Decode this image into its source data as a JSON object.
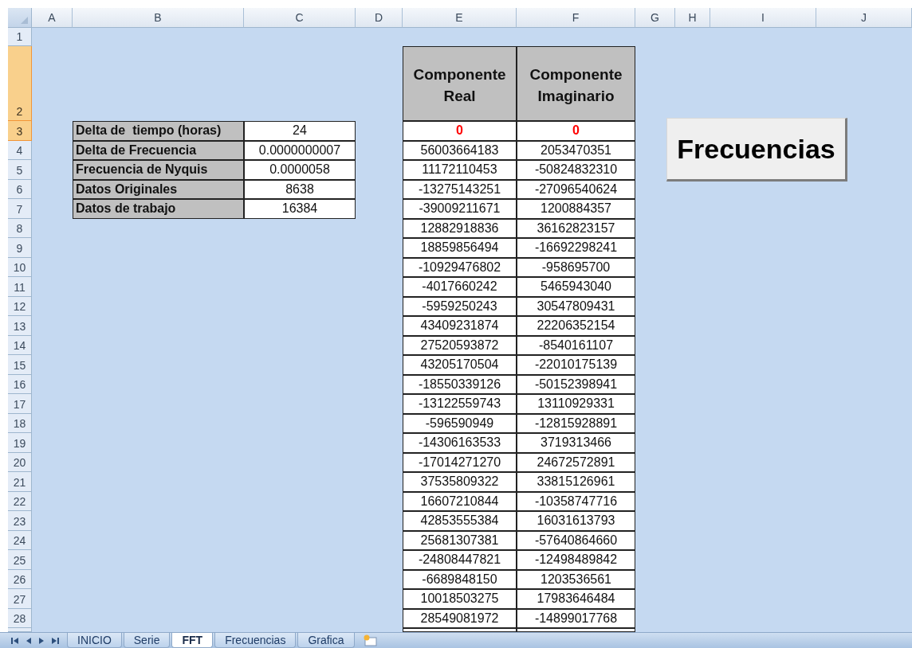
{
  "columns": [
    "A",
    "B",
    "C",
    "D",
    "E",
    "F",
    "G",
    "H",
    "I",
    "J"
  ],
  "rows": [
    {
      "label": "1",
      "selected": false
    },
    {
      "label": "2",
      "selected": true
    },
    {
      "label": "3",
      "selected": true
    },
    {
      "label": "4",
      "selected": false
    },
    {
      "label": "5",
      "selected": false
    },
    {
      "label": "6",
      "selected": false
    },
    {
      "label": "7",
      "selected": false
    },
    {
      "label": "8",
      "selected": false
    },
    {
      "label": "9",
      "selected": false
    },
    {
      "label": "10",
      "selected": false
    },
    {
      "label": "11",
      "selected": false
    },
    {
      "label": "12",
      "selected": false
    },
    {
      "label": "13",
      "selected": false
    },
    {
      "label": "14",
      "selected": false
    },
    {
      "label": "15",
      "selected": false
    },
    {
      "label": "16",
      "selected": false
    },
    {
      "label": "17",
      "selected": false
    },
    {
      "label": "18",
      "selected": false
    },
    {
      "label": "19",
      "selected": false
    },
    {
      "label": "20",
      "selected": false
    },
    {
      "label": "21",
      "selected": false
    },
    {
      "label": "22",
      "selected": false
    },
    {
      "label": "23",
      "selected": false
    },
    {
      "label": "24",
      "selected": false
    },
    {
      "label": "25",
      "selected": false
    },
    {
      "label": "26",
      "selected": false
    },
    {
      "label": "27",
      "selected": false
    },
    {
      "label": "28",
      "selected": false
    }
  ],
  "parameters": [
    {
      "label": "Delta de  tiempo (horas)",
      "value": "24"
    },
    {
      "label": "Delta de Frecuencia",
      "value": "0.0000000007"
    },
    {
      "label": "Frecuencia de Nyquis",
      "value": "0.0000058"
    },
    {
      "label": "Datos Originales",
      "value": "8638"
    },
    {
      "label": "Datos de trabajo",
      "value": "16384"
    }
  ],
  "fft_table": {
    "columns": [
      "Componente Real",
      "Componente Imaginario"
    ],
    "rows": [
      {
        "kind": "highlight",
        "real": "0",
        "imaginary": "0"
      },
      {
        "kind": "value",
        "real": "56003664183",
        "imaginary": "2053470351"
      },
      {
        "kind": "value",
        "real": "11172110453",
        "imaginary": "-50824832310"
      },
      {
        "kind": "value",
        "real": "-13275143251",
        "imaginary": "-27096540624"
      },
      {
        "kind": "value",
        "real": "-39009211671",
        "imaginary": "1200884357"
      },
      {
        "kind": "value",
        "real": "12882918836",
        "imaginary": "36162823157"
      },
      {
        "kind": "value",
        "real": "18859856494",
        "imaginary": "-16692298241"
      },
      {
        "kind": "value",
        "real": "-10929476802",
        "imaginary": "-958695700"
      },
      {
        "kind": "value",
        "real": "-4017660242",
        "imaginary": "5465943040"
      },
      {
        "kind": "value",
        "real": "-5959250243",
        "imaginary": "30547809431"
      },
      {
        "kind": "value",
        "real": "43409231874",
        "imaginary": "22206352154"
      },
      {
        "kind": "value",
        "real": "27520593872",
        "imaginary": "-8540161107"
      },
      {
        "kind": "value",
        "real": "43205170504",
        "imaginary": "-22010175139"
      },
      {
        "kind": "value",
        "real": "-18550339126",
        "imaginary": "-50152398941"
      },
      {
        "kind": "value",
        "real": "-13122559743",
        "imaginary": "13110929331"
      },
      {
        "kind": "value",
        "real": "-596590949",
        "imaginary": "-12815928891"
      },
      {
        "kind": "value",
        "real": "-14306163533",
        "imaginary": "3719313466"
      },
      {
        "kind": "value",
        "real": "-17014271270",
        "imaginary": "24672572891"
      },
      {
        "kind": "value",
        "real": "37535809322",
        "imaginary": "33815126961"
      },
      {
        "kind": "value",
        "real": "16607210844",
        "imaginary": "-10358747716"
      },
      {
        "kind": "value",
        "real": "42853555384",
        "imaginary": "16031613793"
      },
      {
        "kind": "value",
        "real": "25681307381",
        "imaginary": "-57640864660"
      },
      {
        "kind": "value",
        "real": "-24808447821",
        "imaginary": "-12498489842"
      },
      {
        "kind": "value",
        "real": "-6689848150",
        "imaginary": "1203536561"
      },
      {
        "kind": "value",
        "real": "10018503275",
        "imaginary": "17983646484"
      },
      {
        "kind": "value",
        "real": "28549081972",
        "imaginary": "-14899017768"
      }
    ]
  },
  "button": "Frecuencias",
  "sheet_tabs": [
    {
      "label": "INICIO",
      "selected": false
    },
    {
      "label": "Serie",
      "selected": false
    },
    {
      "label": "FFT",
      "selected": true
    },
    {
      "label": "Frecuencias",
      "selected": false
    },
    {
      "label": "Grafica",
      "selected": false
    }
  ]
}
